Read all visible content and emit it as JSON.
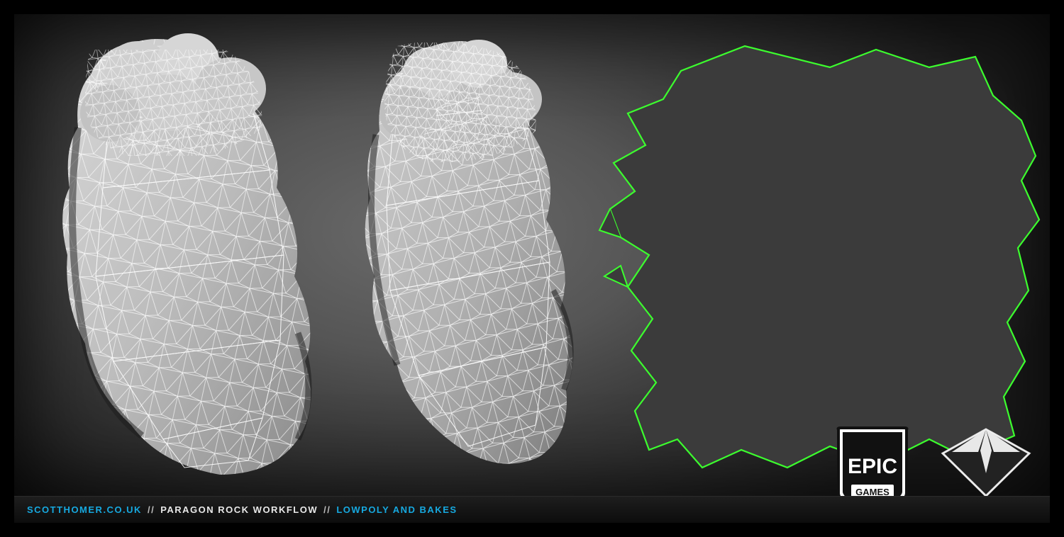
{
  "footer": {
    "site": "SCOTTHOMER.CO.UK",
    "sep": "//",
    "title": "PARAGON ROCK WORKFLOW",
    "subtitle": "LOWPOLY AND BAKES"
  },
  "logos": {
    "epic_top": "EPIC",
    "epic_bottom": "GAMES",
    "paragon": "PARAGON"
  },
  "meshes": {
    "left_label": "lowpoly-rock-view-1",
    "mid_label": "lowpoly-rock-view-2",
    "right_label": "uv-layout-wireframe"
  },
  "colors": {
    "accent": "#16a9e0",
    "uv_edge": "#3cff2e"
  }
}
